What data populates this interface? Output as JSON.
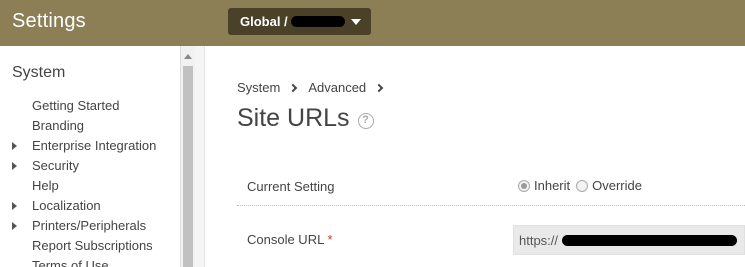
{
  "app": {
    "title": "Settings"
  },
  "scope": {
    "label": "Global /"
  },
  "sidebar": {
    "heading": "System",
    "items": [
      {
        "label": "Getting Started",
        "expandable": false
      },
      {
        "label": "Branding",
        "expandable": false
      },
      {
        "label": "Enterprise Integration",
        "expandable": true
      },
      {
        "label": "Security",
        "expandable": true
      },
      {
        "label": "Help",
        "expandable": false
      },
      {
        "label": "Localization",
        "expandable": true
      },
      {
        "label": "Printers/Peripherals",
        "expandable": true
      },
      {
        "label": "Report Subscriptions",
        "expandable": false
      },
      {
        "label": "Terms of Use",
        "expandable": false
      }
    ]
  },
  "breadcrumb": {
    "items": [
      "System",
      "Advanced"
    ]
  },
  "page": {
    "title": "Site URLs"
  },
  "current_setting": {
    "label": "Current Setting",
    "options": [
      "Inherit",
      "Override"
    ],
    "selected": "Inherit"
  },
  "console_url": {
    "label": "Console URL",
    "required_mark": "*",
    "value_prefix": "https://"
  }
}
